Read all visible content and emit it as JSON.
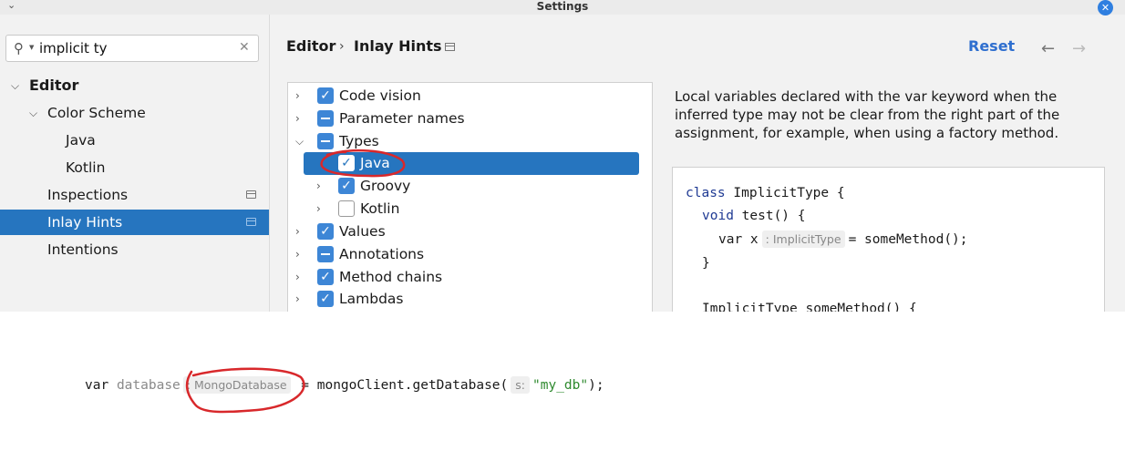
{
  "window": {
    "title": "Settings"
  },
  "sidebar": {
    "search_value": "implicit ty",
    "items": [
      {
        "label": "Editor"
      },
      {
        "label": "Color Scheme"
      },
      {
        "label": "Java"
      },
      {
        "label": "Kotlin"
      },
      {
        "label": "Inspections"
      },
      {
        "label": "Inlay Hints"
      },
      {
        "label": "Intentions"
      }
    ],
    "selected": "Inlay Hints"
  },
  "header": {
    "breadcrumb": [
      "Editor",
      "Inlay Hints"
    ],
    "reset_label": "Reset"
  },
  "options": [
    {
      "label": "Code vision",
      "state": "checked"
    },
    {
      "label": "Parameter names",
      "state": "partial"
    },
    {
      "label": "Types",
      "state": "partial"
    },
    {
      "label": "Java",
      "state": "checked",
      "selected": true
    },
    {
      "label": "Groovy",
      "state": "checked"
    },
    {
      "label": "Kotlin",
      "state": "unchecked"
    },
    {
      "label": "Values",
      "state": "checked"
    },
    {
      "label": "Annotations",
      "state": "partial"
    },
    {
      "label": "Method chains",
      "state": "checked"
    },
    {
      "label": "Lambdas",
      "state": "checked"
    }
  ],
  "description": "Local variables declared with the var keyword when the inferred type may not be clear from the right part of the assignment, for example, when using a factory method.",
  "preview": {
    "line1_kw": "class",
    "line1_rest": " ImplicitType {",
    "line2_kw": "void",
    "line2_rest": " test() {",
    "line3_kw": "var",
    "line3_var": " x",
    "line3_hint": ": ImplicitType",
    "line3_rest": "= someMethod();",
    "line4": "}",
    "line5": "ImplicitType someMethod() {"
  },
  "snippet": {
    "kw": "var",
    "varname": "database",
    "type_hint": ": MongoDatabase",
    "rest": "= mongoClient.getDatabase(",
    "param_hint": "s:",
    "arg": "\"my_db\"",
    "end": ");"
  },
  "colors": {
    "selection": "#2675bf",
    "checkbox": "#3d86d6",
    "link": "#2f6fcf",
    "annotation": "#d8282b"
  }
}
